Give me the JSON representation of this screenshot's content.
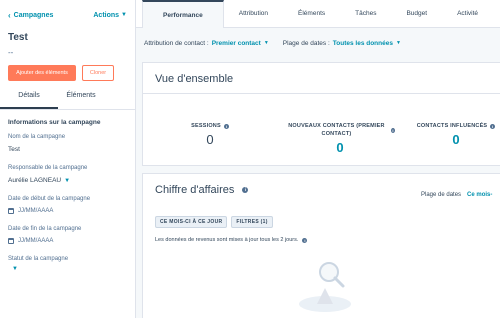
{
  "sidebar": {
    "back_label": "Campagnes",
    "actions_label": "Actions",
    "title": "Test",
    "dash": "--",
    "add_elements_button": "Ajouter des éléments",
    "clone_button": "Cloner",
    "tabs": [
      {
        "label": "Détails",
        "active": true
      },
      {
        "label": "Éléments",
        "active": false
      }
    ],
    "section_title": "Informations sur la campagne",
    "fields": {
      "name_label": "Nom de la campagne",
      "name_value": "Test",
      "owner_label": "Responsable de la campagne",
      "owner_value": "Aurélie LAGNEAU",
      "start_label": "Date de début de la campagne",
      "start_value": "JJ/MM/AAAA",
      "end_label": "Date de fin de la campagne",
      "end_value": "JJ/MM/AAAA",
      "status_label": "Statut de la campagne"
    }
  },
  "topnav": {
    "tabs": [
      {
        "label": "Performance",
        "active": true
      },
      {
        "label": "Attribution",
        "active": false
      },
      {
        "label": "Éléments",
        "active": false
      },
      {
        "label": "Tâches",
        "active": false
      },
      {
        "label": "Budget",
        "active": false
      },
      {
        "label": "Activité",
        "active": false
      }
    ]
  },
  "filters": {
    "attribution_label": "Attribution de contact :",
    "attribution_value": "Premier contact",
    "range_label": "Plage de dates :",
    "range_value": "Toutes les données"
  },
  "overview": {
    "title": "Vue d'ensemble",
    "stats": [
      {
        "label": "SESSIONS",
        "value": "0"
      },
      {
        "label": "NOUVEAUX CONTACTS (PREMIER CONTACT)",
        "value": "0"
      },
      {
        "label": "CONTACTS INFLUENCÉS",
        "value": "0"
      }
    ]
  },
  "revenue": {
    "title": "Chiffre d'affaires",
    "range_label": "Plage de dates",
    "range_value": "Ce mois-",
    "chips": [
      "CE MOIS-CI À CE JOUR",
      "FILTRES (1)"
    ],
    "note": "Les données de revenus sont mises à jour tous les 2 jours."
  },
  "colors": {
    "accent": "#0091ae",
    "primary_button": "#ff7a59",
    "text": "#33475b",
    "background": "#f5f8fa"
  }
}
